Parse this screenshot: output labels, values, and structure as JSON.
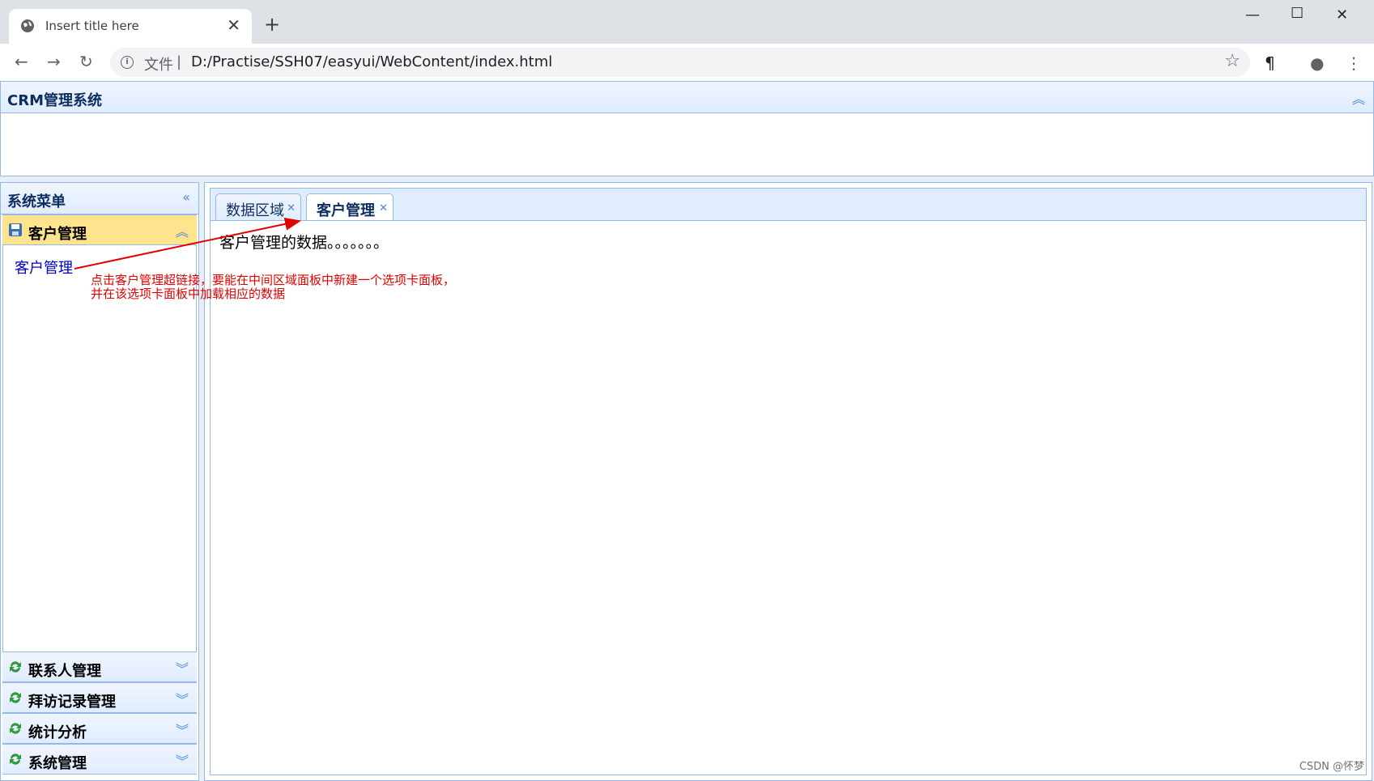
{
  "browser": {
    "tab_title": "Insert title here",
    "url_prefix": "文件",
    "url": "D:/Practise/SSH07/easyui/WebContent/index.html"
  },
  "north": {
    "title": "CRM管理系统"
  },
  "west": {
    "title": "系统菜单",
    "sections": [
      {
        "label": "客户管理",
        "icon": "floppy-disk-icon",
        "selected": true,
        "links": [
          "客户管理"
        ]
      },
      {
        "label": "联系人管理",
        "icon": "refresh-icon"
      },
      {
        "label": "拜访记录管理",
        "icon": "refresh-icon"
      },
      {
        "label": "统计分析",
        "icon": "refresh-icon"
      },
      {
        "label": "系统管理",
        "icon": "refresh-icon"
      }
    ]
  },
  "center": {
    "tabs": [
      {
        "label": "数据区域",
        "active": false
      },
      {
        "label": "客户管理",
        "active": true
      }
    ],
    "content": "客户管理的数据。。。。。。。"
  },
  "annotation": {
    "line1": "点击客户管理超链接，要能在中间区域面板中新建一个选项卡面板，",
    "line2": "并在该选项卡面板中加载相应的数据"
  },
  "watermark": "CSDN @怀梦",
  "colors": {
    "panel_border": "#95b8e7",
    "header_bg": "#e0ecff",
    "selected_bg": "#ffe48d",
    "annotation": "#e00000"
  }
}
